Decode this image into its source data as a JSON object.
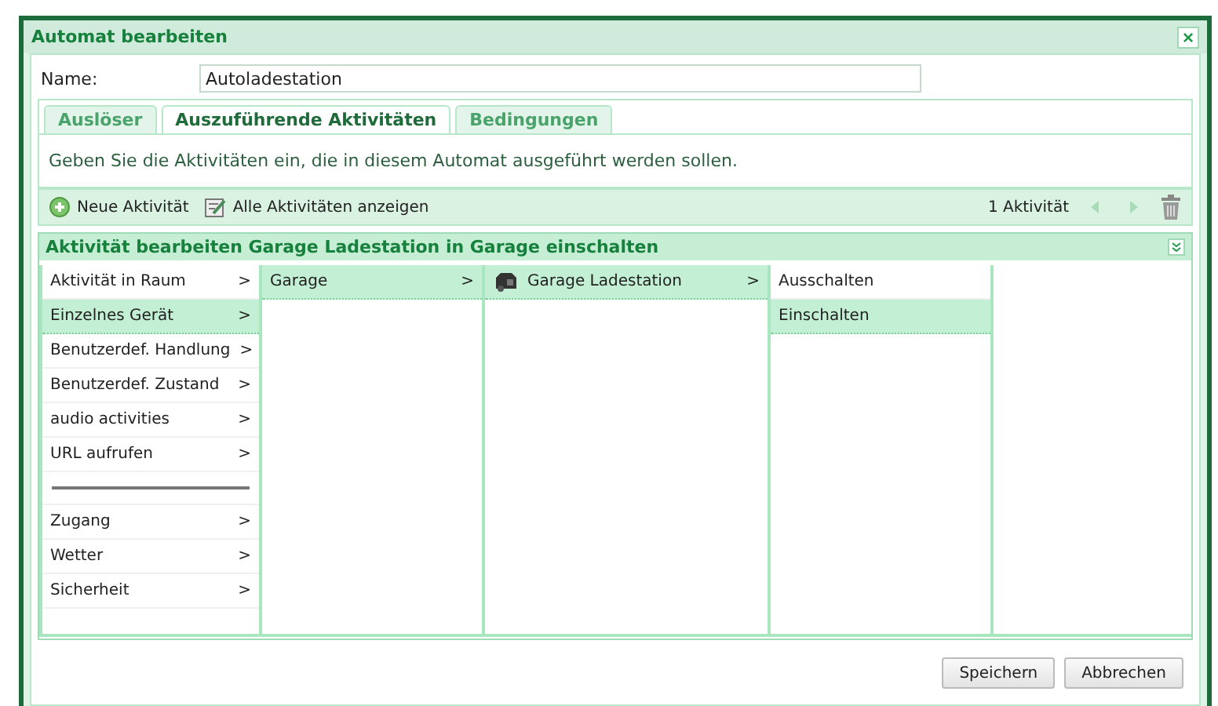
{
  "window": {
    "title": "Automat bearbeiten",
    "close": "×"
  },
  "name_field": {
    "label": "Name:",
    "value": "Autoladestation"
  },
  "tabs": [
    {
      "label": "Auslöser",
      "selected": false
    },
    {
      "label": "Auszuführende Aktivitäten",
      "selected": true
    },
    {
      "label": "Bedingungen",
      "selected": false
    }
  ],
  "description": "Geben Sie die Aktivitäten ein, die in diesem Automat ausgeführt werden sollen.",
  "toolbar": {
    "new": "Neue Aktivität",
    "show_all": "Alle Aktivitäten anzeigen",
    "count": "1 Aktivität"
  },
  "panel": {
    "title": "Aktivität bearbeiten Garage Ladestation in Garage einschalten"
  },
  "columns": [
    {
      "items": [
        {
          "kind": "item",
          "label": "Aktivität in Raum",
          "arrow": ">",
          "selected": false
        },
        {
          "kind": "item",
          "label": "Einzelnes Gerät",
          "arrow": ">",
          "selected": true
        },
        {
          "kind": "item",
          "label": "Benutzerdef. Handlung",
          "arrow": ">",
          "selected": false
        },
        {
          "kind": "item",
          "label": "Benutzerdef. Zustand",
          "arrow": ">",
          "selected": false
        },
        {
          "kind": "item",
          "label": "audio activities",
          "arrow": ">",
          "selected": false
        },
        {
          "kind": "item",
          "label": "URL aufrufen",
          "arrow": ">",
          "selected": false
        },
        {
          "kind": "separator"
        },
        {
          "kind": "item",
          "label": "Zugang",
          "arrow": ">",
          "selected": false
        },
        {
          "kind": "item",
          "label": "Wetter",
          "arrow": ">",
          "selected": false
        },
        {
          "kind": "item",
          "label": "Sicherheit",
          "arrow": ">",
          "selected": false
        }
      ]
    },
    {
      "items": [
        {
          "kind": "item",
          "label": "Garage",
          "arrow": ">",
          "selected": true
        }
      ]
    },
    {
      "items": [
        {
          "kind": "device",
          "label": "Garage Ladestation",
          "arrow": ">",
          "selected": true
        }
      ]
    },
    {
      "items": [
        {
          "kind": "item",
          "label": "Ausschalten",
          "selected": false
        },
        {
          "kind": "item",
          "label": "Einschalten",
          "selected": true
        }
      ]
    }
  ],
  "buttons": [
    "Speichern",
    "Abbrechen"
  ]
}
